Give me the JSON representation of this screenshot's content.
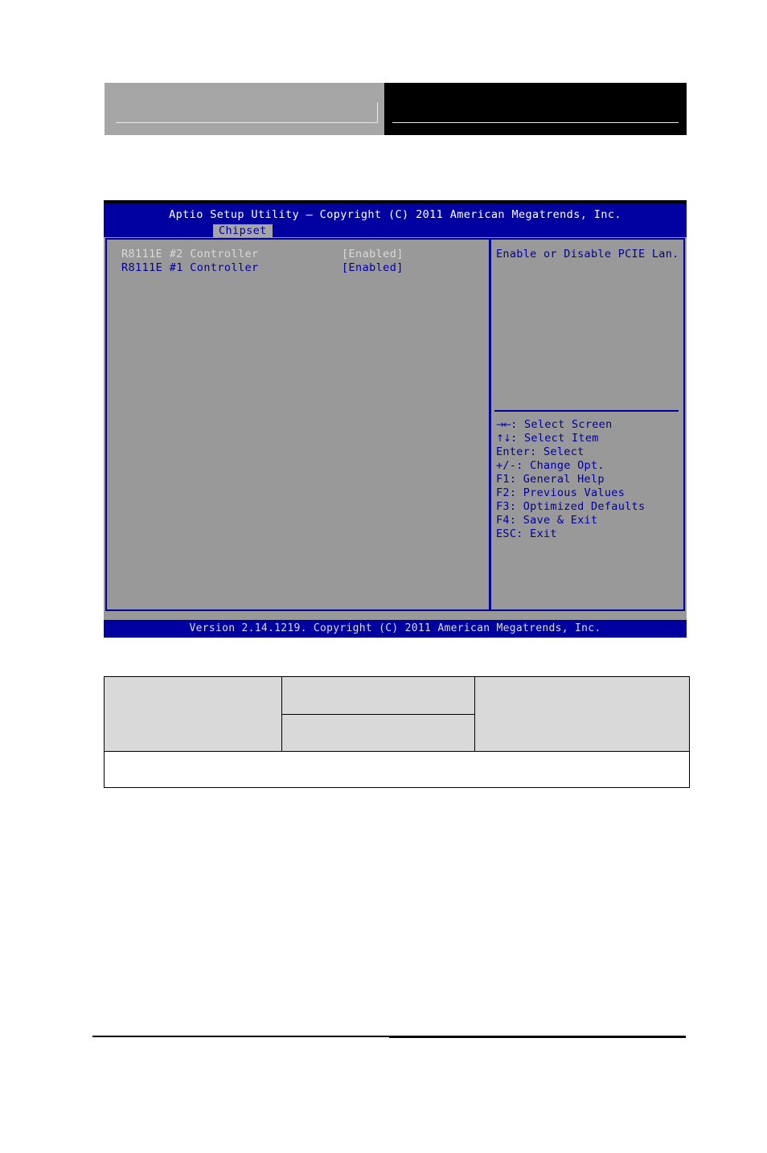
{
  "header": {
    "left_box": {
      "style": "gray"
    },
    "right_box": {
      "style": "black"
    }
  },
  "bios": {
    "title": "Aptio Setup Utility – Copyright (C) 2011 American Megatrends, Inc.",
    "tab": "Chipset",
    "items": [
      {
        "label": "R8111E #2 Controller",
        "value": "[Enabled]",
        "selected": true
      },
      {
        "label": "R8111E #1 Controller",
        "value": "[Enabled]",
        "selected": false
      }
    ],
    "help_text": "Enable or Disable PCIE Lan.",
    "keys": [
      {
        "glyph": "→←",
        "text": ": Select Screen"
      },
      {
        "glyph": "↑↓",
        "text": ": Select Item"
      },
      {
        "glyph": "",
        "text": "Enter: Select"
      },
      {
        "glyph": "",
        "text": "+/-: Change Opt."
      },
      {
        "glyph": "",
        "text": "F1: General Help"
      },
      {
        "glyph": "",
        "text": "F2: Previous Values"
      },
      {
        "glyph": "",
        "text": "F3: Optimized Defaults"
      },
      {
        "glyph": "",
        "text": "F4: Save & Exit"
      },
      {
        "glyph": "",
        "text": "ESC: Exit"
      }
    ],
    "footer": "Version 2.14.1219. Copyright (C) 2011 American Megatrends, Inc.",
    "colors": {
      "background_blue": "#0000a0",
      "body_gray": "#999999",
      "text_blue": "#0000a0",
      "text_light": "#d9d9d9"
    }
  },
  "bottom_table": {
    "rows": [
      {
        "cells": [
          "",
          "",
          ""
        ]
      },
      {
        "cells": [
          ""
        ]
      }
    ]
  }
}
